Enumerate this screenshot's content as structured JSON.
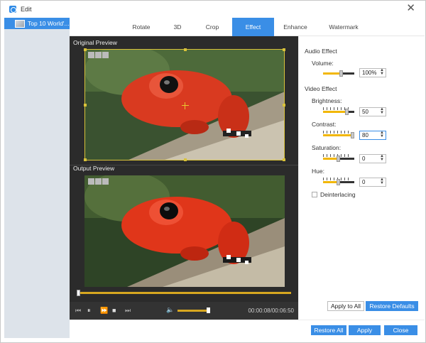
{
  "window": {
    "title": "Edit",
    "close_glyph": "✕"
  },
  "sidebar": {
    "items": [
      {
        "label": "Top 10 World'..."
      }
    ]
  },
  "tabs": [
    {
      "label": "Rotate"
    },
    {
      "label": "3D"
    },
    {
      "label": "Crop"
    },
    {
      "label": "Effect",
      "active": true
    },
    {
      "label": "Enhance"
    },
    {
      "label": "Watermark"
    }
  ],
  "preview": {
    "original_label": "Original Preview",
    "output_label": "Output Preview",
    "timecode": "00:00:08/00:06:50",
    "progress": 0.0,
    "volume": 0.95
  },
  "audio_effect": {
    "heading": "Audio Effect",
    "volume_label": "Volume:",
    "volume_value": "100%",
    "volume_level": 0.6
  },
  "video_effect": {
    "heading": "Video Effect",
    "brightness_label": "Brightness:",
    "brightness_value": "50",
    "contrast_label": "Contrast:",
    "contrast_value": "80",
    "saturation_label": "Saturation:",
    "saturation_value": "0",
    "hue_label": "Hue:",
    "hue_value": "0",
    "deinterlacing_label": "Deinterlacing",
    "deinterlacing_checked": false
  },
  "buttons": {
    "apply_to_all": "Apply to All",
    "restore_defaults": "Restore Defaults",
    "restore_all": "Restore All",
    "apply": "Apply",
    "close": "Close"
  },
  "colors": {
    "accent": "#3a8ee6",
    "slider_fill": "#f2b705",
    "timeline": "#d7a720"
  }
}
